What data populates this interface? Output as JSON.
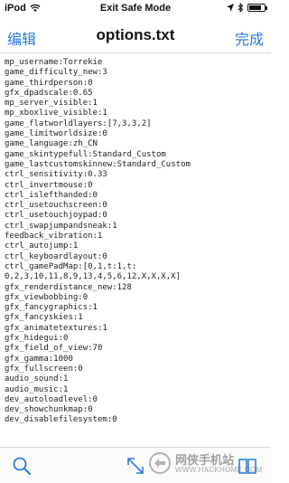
{
  "status_bar": {
    "carrier": "iPod",
    "mode_label": "Exit Safe Mode"
  },
  "nav": {
    "edit_label": "编辑",
    "title": "options.txt",
    "done_label": "完成"
  },
  "file_lines": [
    "mp_username:Torrekie",
    "game_difficulty_new:3",
    "game_thirdperson:0",
    "gfx_dpadscale:0.65",
    "mp_server_visible:1",
    "mp_xboxlive_visible:1",
    "game_flatworldlayers:[7,3,3,2]",
    "game_limitworldsize:0",
    "game_language:zh_CN",
    "game_skintypefull:Standard_Custom",
    "game_lastcustomskinnew:Standard_Custom",
    "ctrl_sensitivity:0.33",
    "ctrl_invertmouse:0",
    "ctrl_islefthanded:0",
    "ctrl_usetouchscreen:0",
    "ctrl_usetouchjoypad:0",
    "ctrl_swapjumpandsneak:1",
    "feedback_vibration:1",
    "ctrl_autojump:1",
    "ctrl_keyboardlayout:0",
    "ctrl_gamePadMap:[0,1,t:1,t:",
    "0,2,3,10,11,8,9,13,4,5,6,12,X,X,X,X]",
    "gfx_renderdistance_new:128",
    "gfx_viewbobbing:0",
    "gfx_fancygraphics:1",
    "gfx_fancyskies:1",
    "gfx_animatetextures:1",
    "gfx_hidegui:0",
    "gfx_field_of_view:70",
    "gfx_gamma:1000",
    "gfx_fullscreen:0",
    "audio_sound:1",
    "audio_music:1",
    "dev_autoloadlevel:0",
    "dev_showchunkmap:0",
    "dev_disablefilesystem:0"
  ],
  "toolbar": {
    "search_icon": "search-icon",
    "expand_icon": "expand-arrows-icon"
  },
  "watermark": {
    "top": "网侠手机站",
    "bottom": "WWW.HACKHOME.COM"
  },
  "colors": {
    "accent": "#2a7bd6",
    "text": "#222222"
  }
}
